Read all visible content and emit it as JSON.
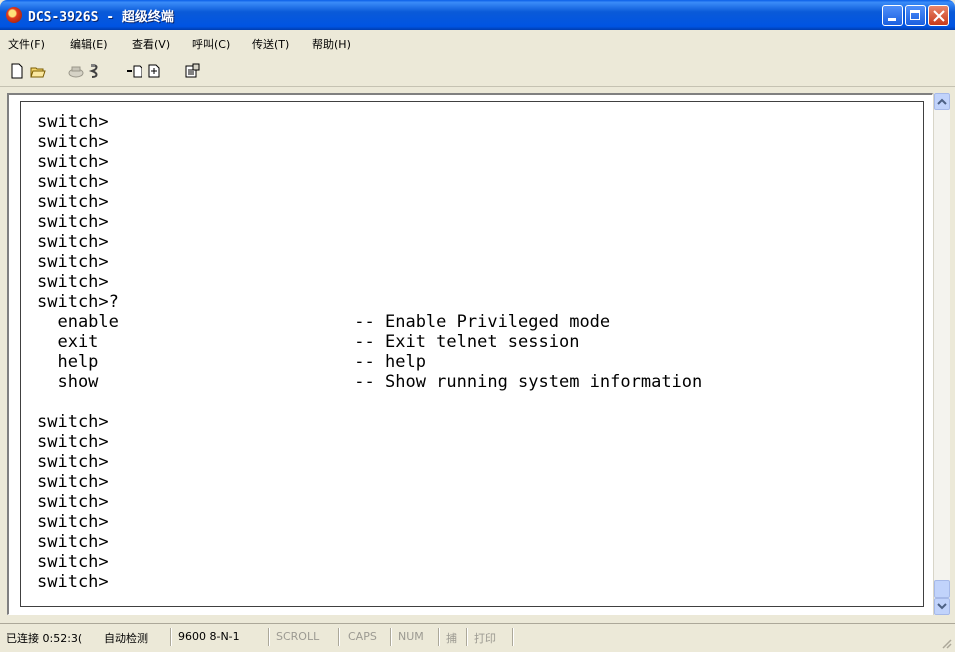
{
  "window": {
    "title": "DCS-3926S - 超级终端"
  },
  "menu": [
    "文件(F)",
    "编辑(E)",
    "查看(V)",
    "呼叫(C)",
    "传送(T)",
    "帮助(H)"
  ],
  "toolbar": {
    "icons": [
      "new-icon",
      "open-icon",
      "disconnect-icon",
      "connect-icon",
      "send-icon",
      "receive-icon",
      "properties-icon"
    ]
  },
  "terminal": {
    "text": "switch>\nswitch>\nswitch>\nswitch>\nswitch>\nswitch>\nswitch>\nswitch>\nswitch>\nswitch>?\n  enable                       -- Enable Privileged mode\n  exit                         -- Exit telnet session\n  help                         -- help\n  show                         -- Show running system information\n\nswitch>\nswitch>\nswitch>\nswitch>\nswitch>\nswitch>\nswitch>\nswitch>\nswitch>"
  },
  "status": {
    "connection": "已连接 0:52:3(",
    "detect": "自动检测",
    "baud": "9600 8-N-1",
    "scroll": "SCROLL",
    "caps": "CAPS",
    "num": "NUM",
    "capture": "捕",
    "print": "打印"
  },
  "colors": {
    "titlebar": "#0054e3",
    "chrome": "#ece9d8",
    "terminal_bg": "#ffffff"
  }
}
